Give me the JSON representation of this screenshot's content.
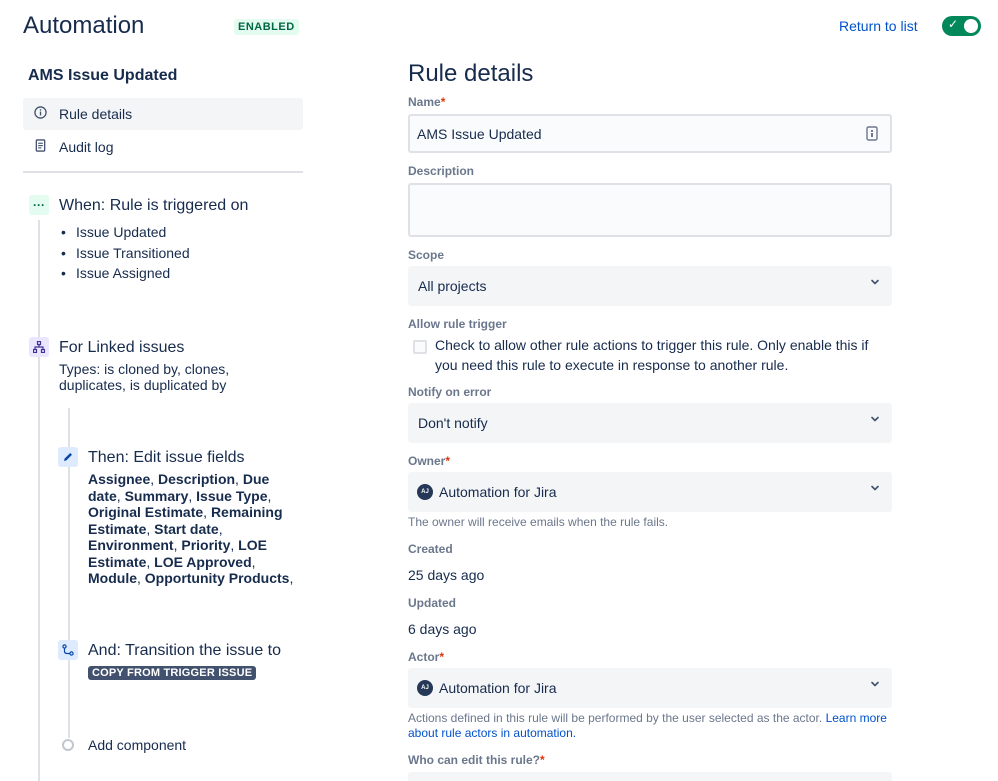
{
  "header": {
    "title": "Automation",
    "status_badge": "ENABLED",
    "return_link": "Return to list",
    "toggle_checked": true
  },
  "sidebar": {
    "rule_name": "AMS Issue Updated",
    "nav": [
      {
        "label": "Rule details",
        "icon": "info-icon",
        "active": true
      },
      {
        "label": "Audit log",
        "icon": "audit-log-icon",
        "active": false
      }
    ]
  },
  "components": {
    "trigger": {
      "title": "When: Rule is triggered on",
      "items": [
        "Issue Updated",
        "Issue Transitioned",
        "Issue Assigned"
      ]
    },
    "branch": {
      "title": "For Linked issues",
      "description": "Types: is cloned by, clones, duplicates, is duplicated by"
    },
    "edit": {
      "title": "Then: Edit issue fields",
      "fields": [
        "Assignee",
        "Description",
        "Due date",
        "Summary",
        "Issue Type",
        "Original Estimate",
        "Remaining Estimate",
        "Start date",
        "Environment",
        "Priority",
        "LOE Estimate",
        "LOE Approved",
        "Module",
        "Opportunity Products"
      ]
    },
    "transition": {
      "title": "And: Transition the issue to",
      "lozenge": "COPY FROM TRIGGER ISSUE"
    },
    "add_component": "Add component"
  },
  "details": {
    "title": "Rule details",
    "name_label": "Name",
    "name_value": "AMS Issue Updated",
    "description_label": "Description",
    "description_value": "",
    "scope_label": "Scope",
    "scope_value": "All projects",
    "allow_trigger_label": "Allow rule trigger",
    "allow_trigger_text": "Check to allow other rule actions to trigger this rule. Only enable this if you need this rule to execute in response to another rule.",
    "notify_label": "Notify on error",
    "notify_value": "Don't notify",
    "owner_label": "Owner",
    "owner_value": "Automation for Jira",
    "owner_avatar": "AJ",
    "owner_helper": "The owner will receive emails when the rule fails.",
    "created_label": "Created",
    "created_value": "25 days ago",
    "updated_label": "Updated",
    "updated_value": "6 days ago",
    "actor_label": "Actor",
    "actor_value": "Automation for Jira",
    "actor_avatar": "AJ",
    "actor_helper": "Actions defined in this rule will be performed by the user selected as the actor. ",
    "actor_helper_link": "Learn more about rule actors in automation.",
    "who_can_edit_label": "Who can edit this rule?"
  },
  "colors": {
    "accent": "#0052cc",
    "enabled_green": "#00875a",
    "trigger_icon_bg": "#e3fcef",
    "branch_icon_bg": "#eae6ff",
    "action_icon_bg": "#deebff"
  }
}
